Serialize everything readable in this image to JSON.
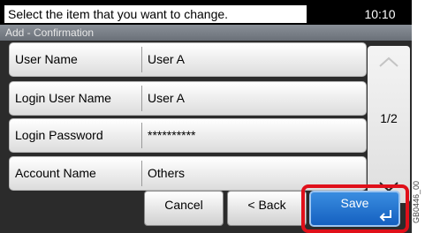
{
  "status": {
    "message": "Select the item that you want to change.",
    "time": "10:10"
  },
  "title": "Add - Confirmation",
  "rows": [
    {
      "label": "User Name",
      "value": "User A"
    },
    {
      "label": "Login User Name",
      "value": "User A"
    },
    {
      "label": "Login Password",
      "value": "**********"
    },
    {
      "label": "Account Name",
      "value": "Others"
    }
  ],
  "pager": {
    "indicator": "1/2"
  },
  "buttons": {
    "cancel": "Cancel",
    "back": "< Back",
    "save": "Save"
  },
  "figure_code": "GB0446_00",
  "icons": {
    "scroll_up": "chevron-up-icon",
    "scroll_down": "chevron-down-icon",
    "enter": "enter-return-icon"
  },
  "colors": {
    "save_button": "#1e6fd0",
    "highlight": "#e0101a"
  }
}
